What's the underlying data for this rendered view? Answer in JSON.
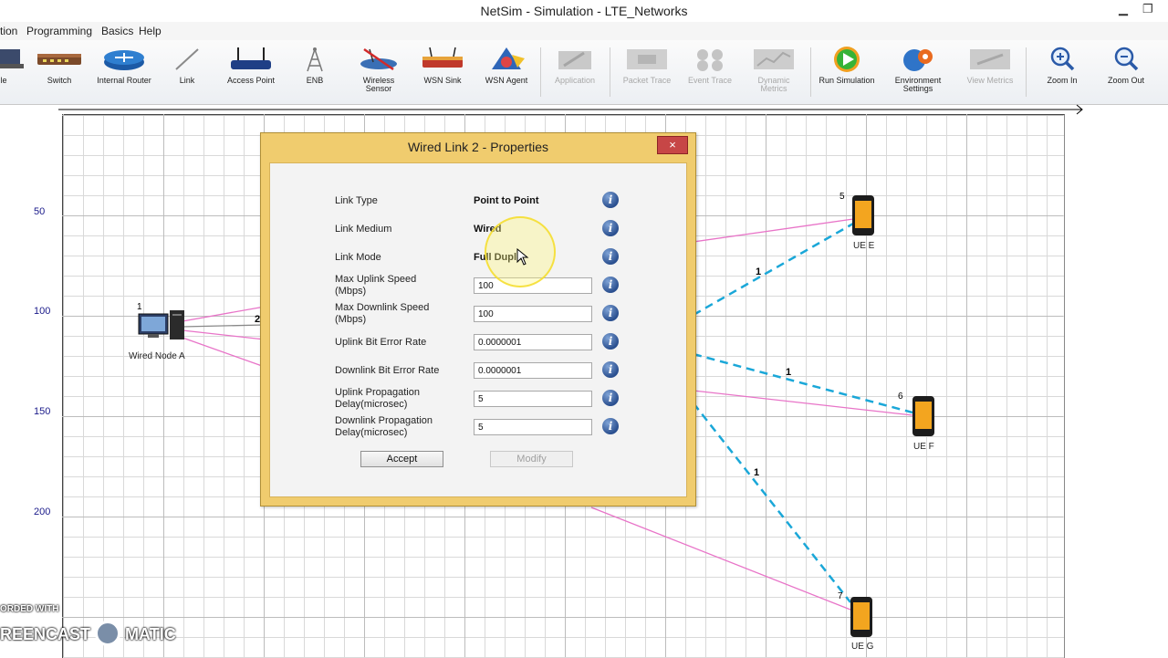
{
  "window": {
    "title": "NetSim - Simulation - LTE_Networks"
  },
  "menu": {
    "items": [
      "tion",
      "Programming",
      "Basics",
      "Help"
    ]
  },
  "toolbar": {
    "tools": [
      {
        "label": "le",
        "icon": "laptop-icon",
        "enabled": true
      },
      {
        "label": "Switch",
        "icon": "switch-icon",
        "enabled": true
      },
      {
        "label": "Internal Router",
        "icon": "router-icon",
        "enabled": true
      },
      {
        "label": "Link",
        "icon": "link-icon",
        "enabled": true
      },
      {
        "label": "Access Point",
        "icon": "access-point-icon",
        "enabled": true
      },
      {
        "label": "ENB",
        "icon": "enb-tower-icon",
        "enabled": true
      },
      {
        "label": "Wireless Sensor",
        "icon": "wireless-sensor-icon",
        "enabled": true
      },
      {
        "label": "WSN Sink",
        "icon": "wsn-sink-icon",
        "enabled": true
      },
      {
        "label": "WSN Agent",
        "icon": "wsn-agent-icon",
        "enabled": true
      },
      {
        "label": "Application",
        "icon": "application-icon",
        "enabled": false
      },
      {
        "label": "Packet Trace",
        "icon": "packet-trace-icon",
        "enabled": false
      },
      {
        "label": "Event Trace",
        "icon": "event-trace-icon",
        "enabled": false
      },
      {
        "label": "Dynamic Metrics",
        "icon": "dynamic-metrics-icon",
        "enabled": false
      },
      {
        "label": "Run Simulation",
        "icon": "run-simulation-icon",
        "enabled": true
      },
      {
        "label": "Environment Settings",
        "icon": "environment-settings-icon",
        "enabled": true
      },
      {
        "label": "View Metrics",
        "icon": "view-metrics-icon",
        "enabled": false
      },
      {
        "label": "Zoom In",
        "icon": "zoom-in-icon",
        "enabled": true
      },
      {
        "label": "Zoom Out",
        "icon": "zoom-out-icon",
        "enabled": true
      }
    ]
  },
  "canvas": {
    "y_ticks": [
      "50",
      "100",
      "150",
      "200"
    ],
    "nodes": {
      "wired_a": {
        "id": "1",
        "label": "Wired Node A"
      },
      "ue_e": {
        "id": "5",
        "label": "UE E"
      },
      "ue_f": {
        "id": "6",
        "label": "UE F"
      },
      "ue_g": {
        "id": "7",
        "label": "UE G"
      }
    },
    "link_ids": {
      "wired": "2",
      "e": "1",
      "f": "1",
      "g": "1"
    },
    "colors": {
      "wired_link": "#e874c8",
      "wireless_link": "#1aa7d8"
    }
  },
  "dialog": {
    "title": "Wired Link 2 - Properties",
    "close": "×",
    "rows": [
      {
        "label": "Link Type",
        "value": "Point to Point",
        "kind": "text"
      },
      {
        "label": "Link Medium",
        "value": "Wired",
        "kind": "text"
      },
      {
        "label": "Link Mode",
        "value": "Full Duplex",
        "kind": "text"
      },
      {
        "label": "Max Uplink Speed (Mbps)",
        "value": "100",
        "kind": "input"
      },
      {
        "label": "Max Downlink Speed (Mbps)",
        "value": "100",
        "kind": "input"
      },
      {
        "label": "Uplink Bit Error Rate",
        "value": "0.0000001",
        "kind": "input"
      },
      {
        "label": "Downlink Bit Error Rate",
        "value": "0.0000001",
        "kind": "input"
      },
      {
        "label": "Uplink Propagation Delay(microsec)",
        "value": "5",
        "kind": "input"
      },
      {
        "label": "Downlink Propagation Delay(microsec)",
        "value": "5",
        "kind": "input"
      }
    ],
    "labels_split": {
      "max_uplink": [
        "Max Uplink Speed",
        "(Mbps)"
      ],
      "max_downlink": [
        "Max Downlink Speed",
        "(Mbps)"
      ],
      "uplink_delay": [
        "Uplink Propagation",
        "Delay(microsec)"
      ],
      "downlink_delay": [
        "Downlink Propagation",
        "Delay(microsec)"
      ]
    },
    "accept_label": "Accept",
    "modify_label": "Modify"
  },
  "watermark": {
    "line1": "ORDED WITH",
    "line2": "REENCAST",
    "line3": "MATIC"
  }
}
